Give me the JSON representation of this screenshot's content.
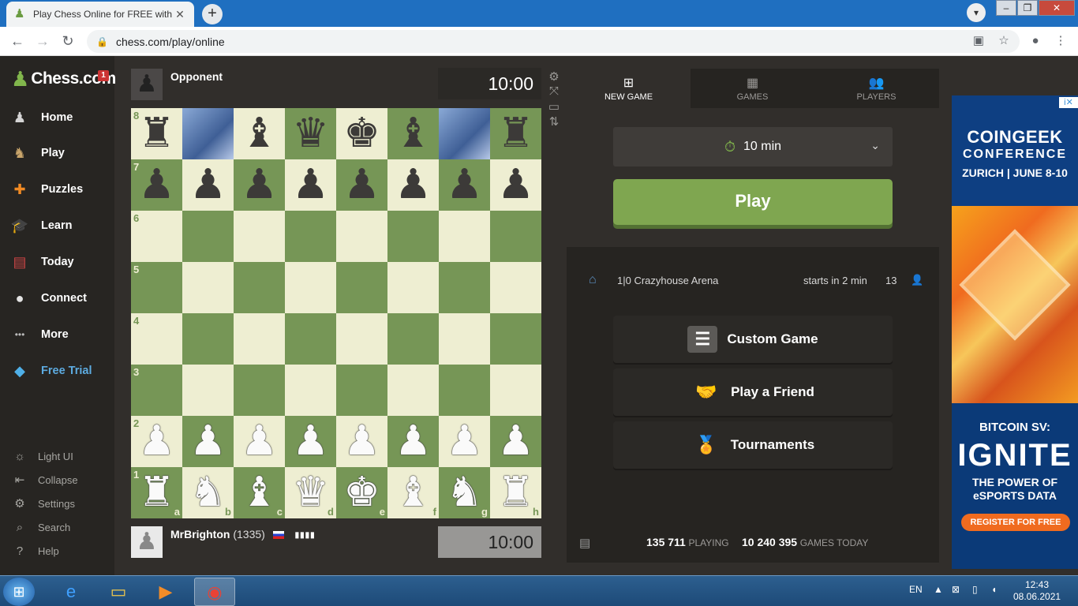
{
  "browser": {
    "tab_title": "Play Chess Online for FREE with F",
    "tab_close": "✕",
    "new_tab": "+",
    "url": "chess.com/play/online"
  },
  "sidebar": {
    "logo_text": "Chess.com",
    "badge": "1",
    "items": [
      {
        "label": "Home",
        "icon": "home-icon",
        "glyph": "♟",
        "color": "#d4d4d4"
      },
      {
        "label": "Play",
        "icon": "play-icon",
        "glyph": "♞",
        "color": "#c9a56b"
      },
      {
        "label": "Puzzles",
        "icon": "puzzle-icon",
        "glyph": "✚",
        "color": "#f08a24"
      },
      {
        "label": "Learn",
        "icon": "learn-icon",
        "glyph": "🎓",
        "color": "#3a6fb0"
      },
      {
        "label": "Today",
        "icon": "today-icon",
        "glyph": "▤",
        "color": "#c94444"
      },
      {
        "label": "Connect",
        "icon": "connect-icon",
        "glyph": "●",
        "color": "#e3e3e3"
      },
      {
        "label": "More",
        "icon": "more-icon",
        "glyph": "•••",
        "color": "#bbbbbb"
      },
      {
        "label": "Free Trial",
        "icon": "diamond-icon",
        "glyph": "◆",
        "color": "#4fb0e8"
      }
    ],
    "sub_items": [
      {
        "label": "Light UI",
        "icon": "sun-icon",
        "glyph": "☼"
      },
      {
        "label": "Collapse",
        "icon": "collapse-icon",
        "glyph": "⇤"
      },
      {
        "label": "Settings",
        "icon": "settings-icon",
        "glyph": "⚙"
      },
      {
        "label": "Search",
        "icon": "search-icon",
        "glyph": "⌕"
      },
      {
        "label": "Help",
        "icon": "help-icon",
        "glyph": "?"
      }
    ]
  },
  "game": {
    "opponent_name": "Opponent",
    "opponent_clock": "10:00",
    "player_name": "MrBrighton",
    "player_rating": "(1335)",
    "player_bars": "▮▮▮▮",
    "player_clock": "10:00",
    "board": [
      [
        "br",
        "photo",
        "bb",
        "bq",
        "bk",
        "bb",
        "photo",
        "br"
      ],
      [
        "bp",
        "bp",
        "bp",
        "bp",
        "bp",
        "bp",
        "bp",
        "bp"
      ],
      [
        "",
        "",
        "",
        "",
        "",
        "",
        "",
        ""
      ],
      [
        "",
        "",
        "",
        "",
        "",
        "",
        "",
        ""
      ],
      [
        "",
        "",
        "",
        "",
        "",
        "",
        "",
        ""
      ],
      [
        "",
        "",
        "",
        "",
        "",
        "",
        "",
        ""
      ],
      [
        "wp",
        "wp",
        "wp",
        "wp",
        "wp",
        "wp",
        "wp",
        "wp"
      ],
      [
        "wr",
        "wn",
        "wb",
        "wq",
        "wk",
        "wb",
        "wn",
        "wr"
      ]
    ],
    "ranks": [
      "8",
      "7",
      "6",
      "5",
      "4",
      "3",
      "2",
      "1"
    ],
    "files": [
      "a",
      "b",
      "c",
      "d",
      "e",
      "f",
      "g",
      "h"
    ]
  },
  "panel": {
    "tabs": [
      {
        "label": "NEW GAME",
        "icon": "plus-square-icon",
        "glyph": "⊞"
      },
      {
        "label": "GAMES",
        "icon": "grid-icon",
        "glyph": "▦"
      },
      {
        "label": "PLAYERS",
        "icon": "players-icon",
        "glyph": "👥"
      }
    ],
    "time_control": "10 min",
    "play_label": "Play",
    "arena": {
      "name": "1|0 Crazyhouse Arena",
      "starts": "starts in 2 min",
      "count": "13"
    },
    "options": [
      {
        "label": "Custom Game",
        "icon": "sliders-icon",
        "glyph": "☰",
        "bg": "#5c5a57"
      },
      {
        "label": "Play a Friend",
        "icon": "handshake-icon",
        "glyph": "🤝",
        "bg": "transparent"
      },
      {
        "label": "Tournaments",
        "icon": "medal-icon",
        "glyph": "🏅",
        "bg": "transparent"
      }
    ],
    "stats": {
      "playing_num": "135 711",
      "playing_label": "PLAYING",
      "games_num": "10 240 395",
      "games_label": "GAMES TODAY"
    }
  },
  "ad": {
    "info": "i✕",
    "brand": "COINGEEK",
    "line2": "CONFERENCE",
    "line3": "ZURICH | JUNE 8-10",
    "headline": "BITCOIN SV:",
    "big": "IGNITE",
    "sub": "THE POWER OF eSPORTS DATA",
    "cta": "REGISTER FOR FREE"
  },
  "taskbar": {
    "lang": "EN",
    "time": "12:43",
    "date": "08.06.2021"
  }
}
